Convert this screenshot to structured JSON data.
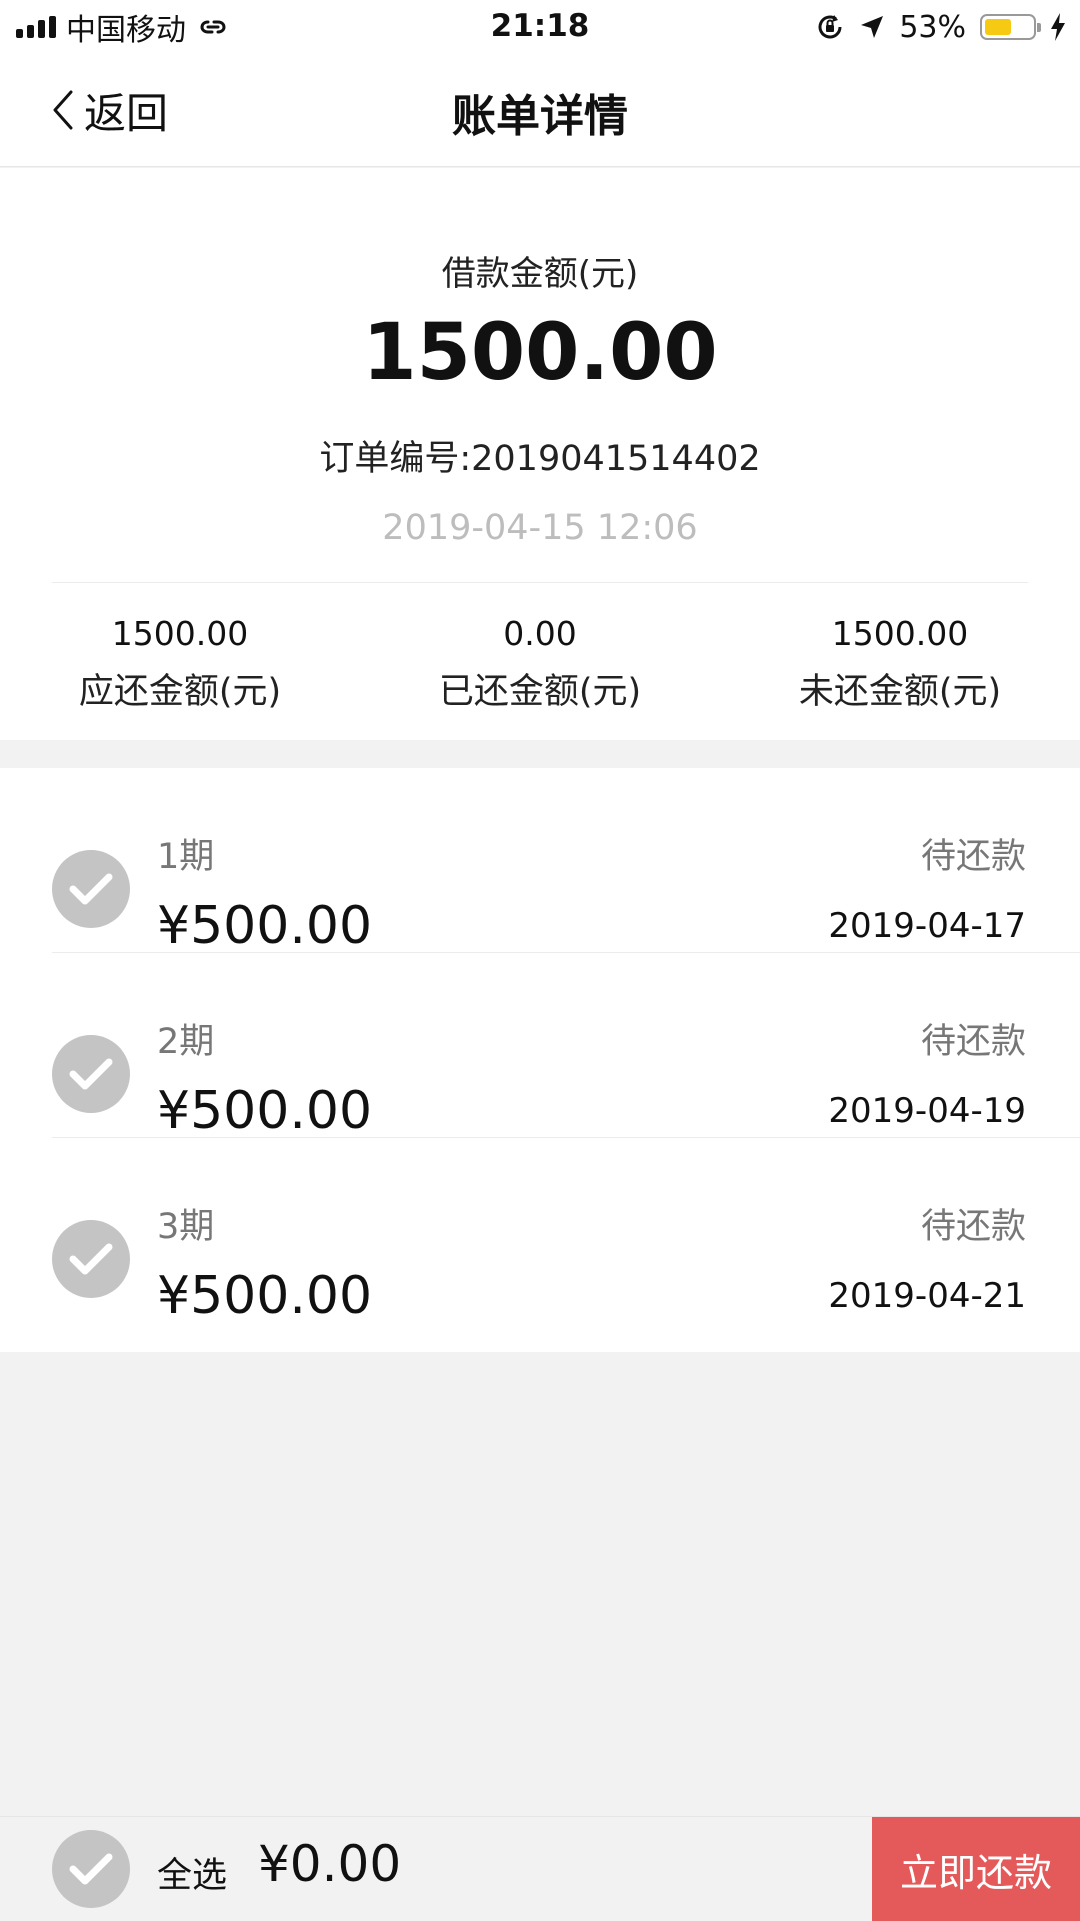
{
  "status_bar": {
    "carrier": "中国移动",
    "time": "21:18",
    "battery": "53%"
  },
  "nav": {
    "back_label": "返回",
    "title": "账单详情"
  },
  "summary": {
    "loan_label": "借款金额(元)",
    "loan_amount": "1500.00",
    "order_label": "订单编号:",
    "order_number": "2019041514402",
    "order_date": "2019-04-15 12:06",
    "stats": [
      {
        "value": "1500.00",
        "label": "应还金额(元)"
      },
      {
        "value": "0.00",
        "label": "已还金额(元)"
      },
      {
        "value": "1500.00",
        "label": "未还金额(元)"
      }
    ]
  },
  "installments": [
    {
      "period": "1期",
      "amount": "¥500.00",
      "status": "待还款",
      "due": "2019-04-17"
    },
    {
      "period": "2期",
      "amount": "¥500.00",
      "status": "待还款",
      "due": "2019-04-19"
    },
    {
      "period": "3期",
      "amount": "¥500.00",
      "status": "待还款",
      "due": "2019-04-21"
    }
  ],
  "bottom": {
    "select_all": "全选",
    "total": "¥0.00",
    "pay_label": "立即还款"
  },
  "colors": {
    "accent": "#e45a5a",
    "check": "#c4c4c4",
    "battery": "#f6c913"
  }
}
